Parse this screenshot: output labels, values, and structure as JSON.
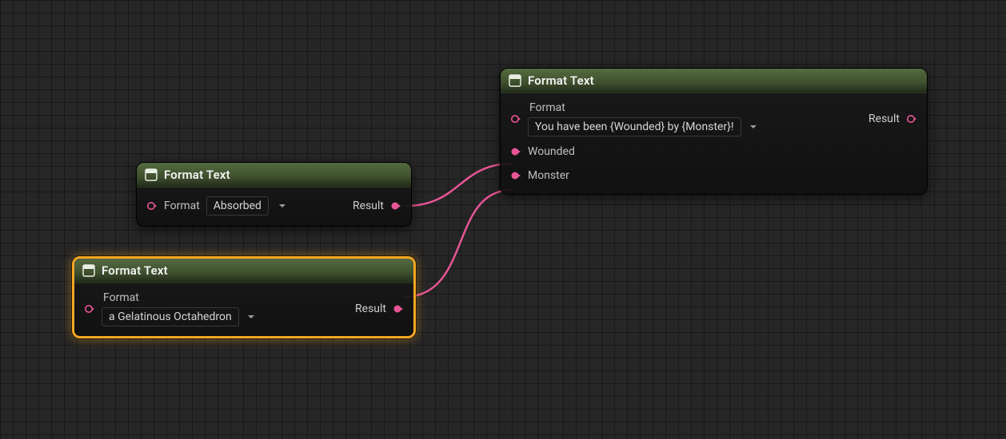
{
  "colors": {
    "pin_text": "#e75596",
    "pin_hollow_stroke": "#e75596",
    "selection": "#f5a623",
    "icon_fill": "#e9eee3"
  },
  "nodes": {
    "a": {
      "title": "Format Text",
      "format_label": "Format",
      "format_value": "Absorbed",
      "result_label": "Result",
      "selected": false
    },
    "b": {
      "title": "Format Text",
      "format_label": "Format",
      "format_value": "a Gelatinous Octahedron",
      "result_label": "Result",
      "selected": true
    },
    "c": {
      "title": "Format Text",
      "format_label": "Format",
      "format_value": "You have been {Wounded} by {Monster}!",
      "result_label": "Result",
      "pins": {
        "wounded": "Wounded",
        "monster": "Monster"
      },
      "selected": false
    }
  }
}
